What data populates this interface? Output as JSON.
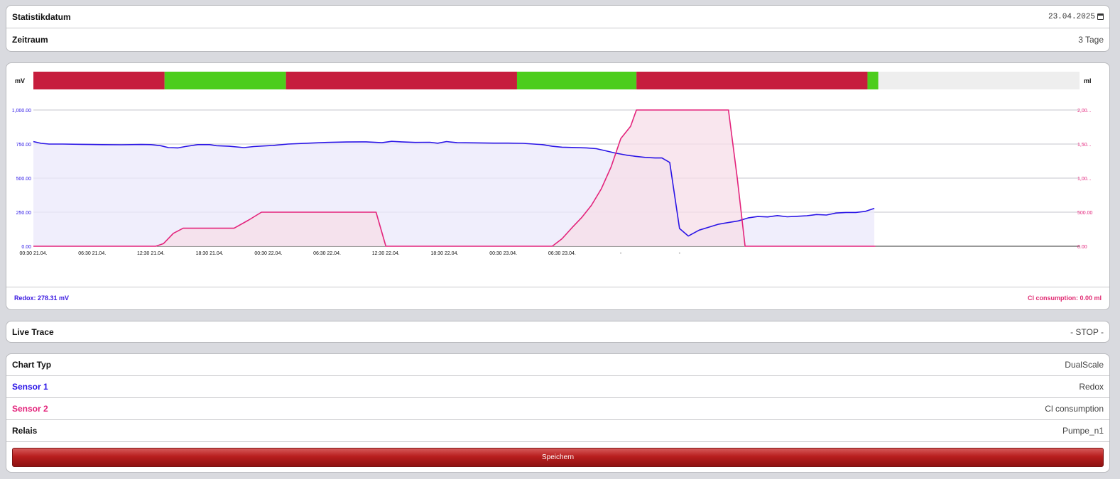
{
  "statistik": {
    "label": "Statistikdatum",
    "value": "23.04.2025"
  },
  "zeitraum": {
    "label": "Zeitraum",
    "value": "3 Tage"
  },
  "chart_data": {
    "type": "line",
    "subtype": "dual-axis area",
    "left_axis_label": "mV",
    "right_axis_label": "ml",
    "left_ticks": [
      "0.00",
      "250.00",
      "500.00",
      "750.00",
      "1,000.00"
    ],
    "left_range": [
      0,
      1000
    ],
    "right_ticks": [
      "0.00",
      "500.00",
      "1,00...",
      "1,50...",
      "2,00..."
    ],
    "right_range": [
      0,
      2000
    ],
    "x_ticks": [
      "00:30 21.04.",
      "06:30 21.04.",
      "12:30 21.04.",
      "18:30 21.04.",
      "00:30 22.04.",
      "06:30 22.04.",
      "12:30 22.04.",
      "18:30 22.04.",
      "00:30 23.04.",
      "06:30 23.04.",
      "-",
      "-"
    ],
    "x_unit": "hours since 00:30 21.04.",
    "x_range": [
      0,
      72
    ],
    "grid": true,
    "series": [
      {
        "name": "Redox",
        "axis": "left",
        "color": "#2a14e6",
        "fill": "#ebe8fb",
        "points": [
          [
            0,
            768
          ],
          [
            0.8,
            755
          ],
          [
            1.6,
            750
          ],
          [
            3,
            750
          ],
          [
            5,
            748
          ],
          [
            7,
            746
          ],
          [
            9,
            745
          ],
          [
            11,
            747
          ],
          [
            12,
            746
          ],
          [
            13,
            738
          ],
          [
            13.8,
            724
          ],
          [
            14.8,
            722
          ],
          [
            15.5,
            732
          ],
          [
            16.8,
            746
          ],
          [
            18,
            746
          ],
          [
            18.7,
            738
          ],
          [
            20,
            734
          ],
          [
            21.5,
            724
          ],
          [
            22.5,
            732
          ],
          [
            24.5,
            740
          ],
          [
            26,
            750
          ],
          [
            28,
            756
          ],
          [
            30,
            762
          ],
          [
            32,
            765
          ],
          [
            34,
            766
          ],
          [
            35.6,
            760
          ],
          [
            36.6,
            770
          ],
          [
            37.6,
            766
          ],
          [
            39,
            762
          ],
          [
            40.5,
            763
          ],
          [
            41.3,
            756
          ],
          [
            42.2,
            768
          ],
          [
            43.3,
            760
          ],
          [
            45,
            759
          ],
          [
            47,
            757
          ],
          [
            48.5,
            757
          ],
          [
            50,
            755
          ],
          [
            52,
            746
          ],
          [
            53,
            734
          ],
          [
            54,
            727
          ],
          [
            55,
            725
          ],
          [
            56.5,
            722
          ],
          [
            57.5,
            716
          ],
          [
            58.5,
            700
          ],
          [
            59.5,
            683
          ],
          [
            60.5,
            670
          ],
          [
            61.5,
            660
          ],
          [
            62.5,
            652
          ],
          [
            63.5,
            648
          ],
          [
            64.2,
            648
          ],
          [
            65,
            615
          ],
          [
            66,
            130
          ],
          [
            66.9,
            75
          ],
          [
            68,
            118
          ],
          [
            69,
            140
          ],
          [
            70,
            162
          ],
          [
            71,
            174
          ],
          [
            72,
            186
          ],
          [
            73,
            208
          ],
          [
            74,
            218
          ],
          [
            75,
            215
          ],
          [
            76,
            225
          ],
          [
            77,
            216
          ],
          [
            78,
            220
          ],
          [
            79,
            224
          ],
          [
            80,
            233
          ],
          [
            81,
            229
          ],
          [
            82,
            244
          ],
          [
            83,
            248
          ],
          [
            84,
            248
          ],
          [
            85,
            256
          ],
          [
            85.9,
            278
          ]
        ]
      },
      {
        "name": "Cl consumption",
        "axis": "right",
        "color": "#e3237b",
        "fill": "#f7dde8",
        "points": [
          [
            0,
            0
          ],
          [
            12.5,
            0
          ],
          [
            13.3,
            40
          ],
          [
            14.3,
            190
          ],
          [
            15.3,
            265
          ],
          [
            20.5,
            265
          ],
          [
            22,
            385
          ],
          [
            23.3,
            500
          ],
          [
            35,
            500
          ],
          [
            36,
            0
          ],
          [
            53,
            0
          ],
          [
            54,
            110
          ],
          [
            55,
            270
          ],
          [
            56,
            420
          ],
          [
            57,
            600
          ],
          [
            58,
            840
          ],
          [
            59,
            1160
          ],
          [
            60,
            1580
          ],
          [
            61,
            1760
          ],
          [
            61.6,
            2000
          ],
          [
            71,
            2000
          ],
          [
            71.9,
            1000
          ],
          [
            72.7,
            0
          ],
          [
            86,
            0
          ]
        ]
      }
    ],
    "status_bar": {
      "segments": [
        {
          "from": 0,
          "to": 13.4,
          "state": "on",
          "color": "#c61d3d"
        },
        {
          "from": 13.4,
          "to": 25.8,
          "state": "off",
          "color": "#4ccd1c"
        },
        {
          "from": 25.8,
          "to": 49.4,
          "state": "on",
          "color": "#c61d3d"
        },
        {
          "from": 49.4,
          "to": 61.6,
          "state": "off",
          "color": "#4ccd1c"
        },
        {
          "from": 61.6,
          "to": 85.2,
          "state": "on",
          "color": "#c61d3d"
        },
        {
          "from": 85.2,
          "to": 86.3,
          "state": "off",
          "color": "#4ccd1c"
        }
      ],
      "background": "#eeeeee"
    },
    "legend": {
      "left": "Redox: 278.31 mV",
      "right": "Cl consumption: 0.00 ml"
    }
  },
  "live_trace": {
    "label": "Live Trace",
    "value": "- STOP -"
  },
  "settings": [
    {
      "label": "Chart Typ",
      "value": "DualScale",
      "color": "#111111"
    },
    {
      "label": "Sensor 1",
      "value": "Redox",
      "color": "#2a14e6"
    },
    {
      "label": "Sensor 2",
      "value": "Cl consumption",
      "color": "#e3237b"
    },
    {
      "label": "Relais",
      "value": "Pumpe_n1",
      "color": "#111111"
    }
  ],
  "save_label": "Speichern"
}
